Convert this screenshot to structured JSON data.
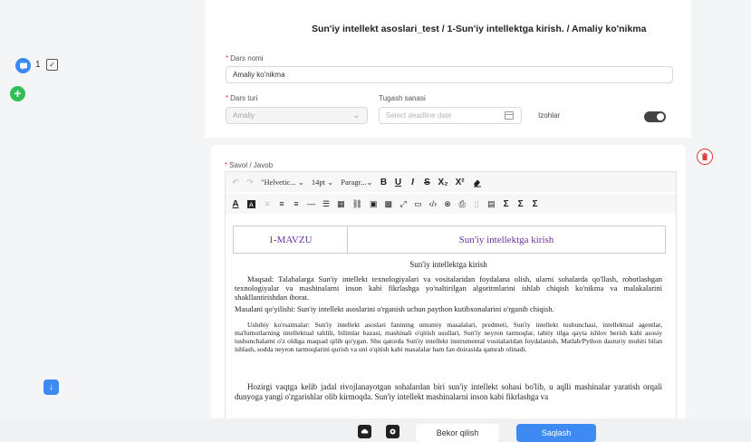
{
  "header": {
    "breadcrumb": "Sun'iy intellekt asoslari_test / 1-Sun'iy intellektga kirish. / Amaliy ko'nikma"
  },
  "sidebar": {
    "question_number": "1",
    "checkbox_mark": "✓",
    "add_label": "+",
    "down_label": "↓"
  },
  "form": {
    "lesson_name_label": "Dars nomi",
    "lesson_name_value": "Amaliy ko'nikma",
    "lesson_type_label": "Dars turi",
    "lesson_type_value": "Amaliy",
    "deadline_label": "Tugash sanasi",
    "deadline_placeholder": "Select deadline date",
    "comments_label": "Izohlar",
    "required_mark": "*"
  },
  "question": {
    "label": "Savol / Javob"
  },
  "toolbar": {
    "undo": "↶",
    "redo": "↷",
    "font_family": "\"Helvetic...",
    "font_size": "14pt",
    "block_format": "Paragr...",
    "bold": "B",
    "underline": "U",
    "italic": "I",
    "strike": "S",
    "subscript": "X₂",
    "superscript": "X²",
    "sigma": "Σ"
  },
  "document": {
    "table_left": "1-MAVZU",
    "table_right": "Sun'iy intellektga kirish",
    "heading": "Sun'iy intellektga kirish",
    "para1": "Maqsad: Talabalarga Sun'iy intellekt texnologiyalari va vositalaridan foydalana olish, ularni sohalarda qo'llash, robotlashgan texnologiyalar va mashinalarni inson kabi fikrlashga yo'naltirilgan algoritmlarini ishlab chiqish ko'nikma va malakalarini shakllantirishdan iborat.",
    "para2": "Masalani qo'yilishi: Sun'iy intellekt asoslarini o'rganish uchun paython kutibxonalarini o'rganib chiqish.",
    "para3": "Uslubiy ko'rsatmalar: Sun'iy intellekt asoslari fanining umumiy masalalari, predmeti, Sun'iy intellekt tushunchasi, intellektual agentlar, ma'lumotlarning intellektual tahlili, bilimlar bazasi, mashinali o'qitish usullari, Sun'iy neyron tarmoqlar, tabiiy tilga qayta ishlov berish kabi asosiy tushunchalarni o'z oldiga maqsad qilib qo'ygan. Shu qatorda Sun'iy intellekt instrumental vositalaridan foydalanish, Matlab/Python dasturiy muhiti bilan ishlash, sodda neyron tarmoqlarini qurish va uni o'qitish kabi masalalar ham fan doirasida qamrab olinadi.",
    "para4": "Hozirgi vaqtga kelib jadal rivojlanayotgan sohalardan biri sun'iy intellekt sohasi bo'lib, u aqlli mashinalar yaratish orqali dunyoga yangi o'zgarishlar olib kirmoqda. Sun'iy intellekt mashinalarni inson kabi fikrlashga va"
  },
  "footer": {
    "cancel_label": "Bekor qilish",
    "save_label": "Saqlash"
  },
  "colors": {
    "accent": "#3d8bf2",
    "success": "#2fbf55",
    "danger": "#e03a3a",
    "doc_heading": "#6b2fa0"
  },
  "icons": [
    "chat-icon",
    "checkbox-icon",
    "plus-icon",
    "arrow-down-icon",
    "trash-icon",
    "upload-icon",
    "settings-icon",
    "calendar-icon",
    "chevron-down-icon"
  ]
}
